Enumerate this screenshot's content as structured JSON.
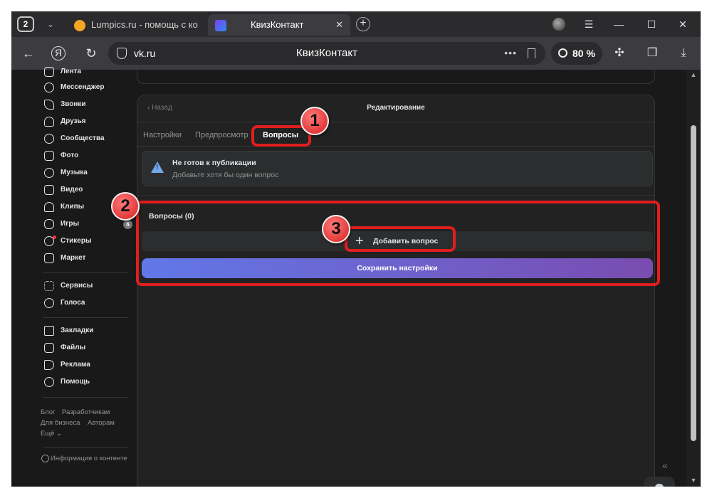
{
  "browser": {
    "tab_count": "2",
    "tabs": [
      {
        "title": "Lumpics.ru - помощь с ко"
      },
      {
        "title": "КвизКонтакт"
      }
    ],
    "new_tab": "+",
    "address": {
      "url": "vk.ru",
      "page_title": "КвизКонтакт",
      "more": "•••"
    },
    "zoom": "80 %"
  },
  "sidebar": {
    "items": [
      {
        "label": "Лента",
        "icon": "feed-icon"
      },
      {
        "label": "Мессенджер",
        "icon": "message-icon"
      },
      {
        "label": "Звонки",
        "icon": "phone-icon"
      },
      {
        "label": "Друзья",
        "icon": "friends-icon"
      },
      {
        "label": "Сообщества",
        "icon": "communities-icon"
      },
      {
        "label": "Фото",
        "icon": "photo-icon"
      },
      {
        "label": "Музыка",
        "icon": "music-icon"
      },
      {
        "label": "Видео",
        "icon": "video-icon"
      },
      {
        "label": "Клипы",
        "icon": "clips-icon"
      },
      {
        "label": "Игры",
        "icon": "games-icon",
        "badge": "6"
      },
      {
        "label": "Стикеры",
        "icon": "stickers-icon"
      },
      {
        "label": "Маркет",
        "icon": "market-icon"
      },
      {
        "label": "Сервисы",
        "icon": "services-icon"
      },
      {
        "label": "Голоса",
        "icon": "votes-icon"
      },
      {
        "label": "Закладки",
        "icon": "bookmarks-icon"
      },
      {
        "label": "Файлы",
        "icon": "files-icon"
      },
      {
        "label": "Реклама",
        "icon": "ads-icon"
      },
      {
        "label": "Помощь",
        "icon": "help-icon"
      }
    ],
    "footer": {
      "blog": "Блог",
      "developers": "Разработчикам",
      "business": "Для бизнеса",
      "authors": "Авторам",
      "more": "Ещё ⌄",
      "content_info": "Информация о контенте"
    }
  },
  "editor": {
    "back": "Назад",
    "title": "Редактирование",
    "tabs": [
      {
        "label": "Настройки"
      },
      {
        "label": "Предпросмотр"
      },
      {
        "label": "Вопросы",
        "active": true
      }
    ],
    "warning": {
      "title": "Не готов к публикации",
      "subtitle": "Добавьте хотя бы один вопрос"
    },
    "questions_title": "Вопросы (0)",
    "add_question": "Добавить вопрос",
    "save": "Сохранить настройки"
  },
  "callouts": [
    "1",
    "2",
    "3"
  ],
  "colors": {
    "accent": "#71aaeb",
    "highlight": "#e01e1e",
    "save_from": "#6178e8",
    "save_to": "#7a4cb0"
  }
}
